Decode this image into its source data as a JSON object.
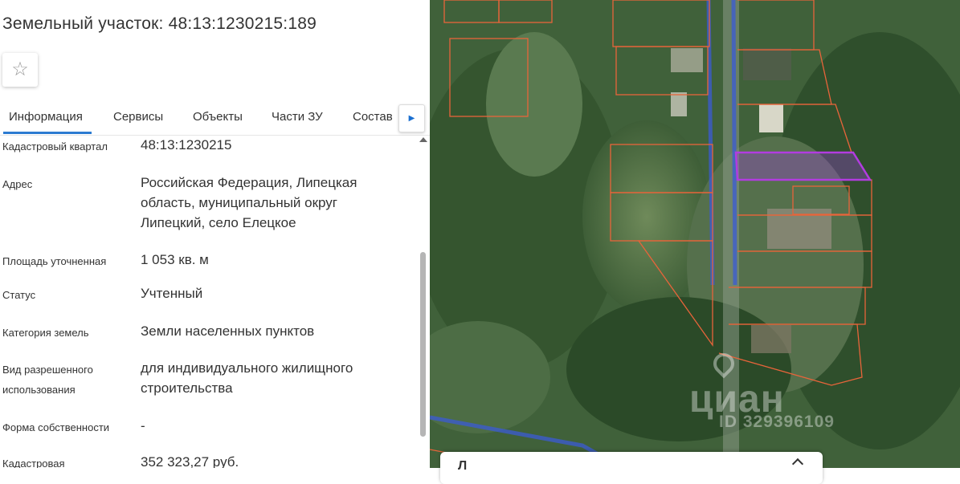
{
  "header": {
    "title": "Земельный участок: 48:13:1230215:189",
    "favorite_icon": "star-outline-icon"
  },
  "tabs": [
    {
      "label": "Информация",
      "active": true
    },
    {
      "label": "Сервисы"
    },
    {
      "label": "Объекты"
    },
    {
      "label": "Части ЗУ"
    },
    {
      "label": "Состав"
    }
  ],
  "tabs_next_icon": "chevron-right-icon",
  "properties": [
    {
      "label": "Кадастровый квартал",
      "value": "48:13:1230215"
    },
    {
      "label": "Адрес",
      "value": "Российская Федерация, Липецкая область, муниципальный округ Липецкий, село Елецкое"
    },
    {
      "label": "Площадь уточненная",
      "value": "1 053 кв. м"
    },
    {
      "label": "Статус",
      "value": "Учтенный"
    },
    {
      "label": "Категория земель",
      "value": "Земли населенных пунктов"
    },
    {
      "label": "Вид разрешенного использования",
      "value": "для индивидуального жилищного строительства"
    },
    {
      "label": "Форма собственности",
      "value": "-"
    },
    {
      "label": "Кадастровая",
      "value": "352 323,27 руб."
    }
  ],
  "map": {
    "watermark": "циан",
    "watermark_id": "ID 329396109",
    "colors": {
      "parcel": "#e8643a",
      "selected": "#b23ce0",
      "road": "#3b5bd6"
    }
  },
  "bottom_panel": {
    "title": "Л"
  }
}
